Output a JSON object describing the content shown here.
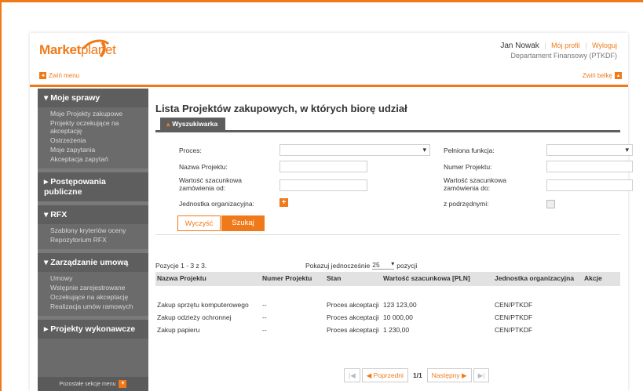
{
  "header": {
    "logo_a": "Market",
    "logo_b": "planet",
    "user_name": "Jan Nowak",
    "my_profile": "Mój profil",
    "logout": "Wyloguj",
    "department": "Departament Finansowy (PTKDF)",
    "collapse_menu": "Zwiń menu",
    "collapse_bar": "Zwiń belkę"
  },
  "sidebar": {
    "sections": [
      {
        "title": "Moje sprawy",
        "arrow": "▾",
        "items": [
          "Moje Projekty zakupowe",
          "Projekty oczekujące na akceptację",
          "Ostrzeżenia",
          "Moje zapytania",
          "Akceptacja zapytań"
        ]
      },
      {
        "title": "Postępowania publiczne",
        "arrow": "▸",
        "items": []
      },
      {
        "title": "RFX",
        "arrow": "▾",
        "items": [
          "Szablony kryteriów oceny",
          "Repozytorium RFX"
        ]
      },
      {
        "title": "Zarządzanie umową",
        "arrow": "▾",
        "items": [
          "Umowy",
          "Wstępnie zarejestrowane",
          "Oczekujące na akceptację",
          "Realizacja umów ramowych"
        ]
      },
      {
        "title": "Projekty wykonawcze",
        "arrow": "▸",
        "items": []
      }
    ],
    "more_label": "Pozostałe sekcje menu"
  },
  "main": {
    "title": "Lista Projektów zakupowych, w których biorę udział",
    "search_tab": "Wyszukiwarka",
    "form": {
      "process_label": "Proces:",
      "process_value": "",
      "function_label": "Pełniona funkcja:",
      "function_value": "",
      "project_name_label": "Nazwa Projektu:",
      "project_number_label": "Numer Projektu:",
      "value_from_label_1": "Wartość szacunkowa",
      "value_from_label_2": "zamówienia od:",
      "value_to_label_1": "Wartość szacunkowa",
      "value_to_label_2": "zamówienia do:",
      "org_unit_label": "Jednostka organizacyjna:",
      "subordinates_label": "z podrzędnymi:",
      "clear_button": "Wyczyść",
      "search_button": "Szukaj"
    },
    "results_info": "Pozycje 1 - 3 z 3.",
    "show_label": "Pokazuj jednocześnie",
    "per_page": "25",
    "positions_label": "pozycji",
    "columns": [
      "Nazwa Projektu",
      "Numer Projektu",
      "Stan",
      "Wartość szacunkowa [PLN]",
      "Jednostka organizacyjna",
      "Akcje"
    ],
    "rows": [
      [
        "Zakup sprzętu komputerowego",
        "--",
        "Proces akceptacji",
        "123 123,00",
        "CEN/PTKDF"
      ],
      [
        "Zakup odzieży ochronnej",
        "--",
        "Proces akceptacji",
        "10 000,00",
        "CEN/PTKDF"
      ],
      [
        "Zakup papieru",
        "--",
        "Proces akceptacji",
        "1 230,00",
        "CEN/PTKDF"
      ]
    ],
    "pager": {
      "prev": "Poprzedni",
      "page": "1/1",
      "next": "Następny"
    }
  },
  "colors": {
    "accent": "#f07a1a",
    "sidebar": "#6b6b6b",
    "sidebar_head": "#5e5e5e"
  }
}
